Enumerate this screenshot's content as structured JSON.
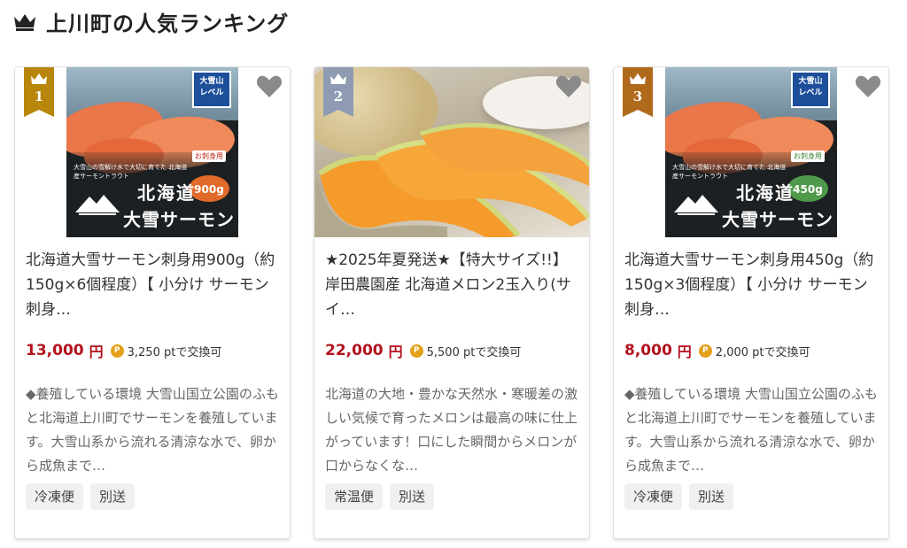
{
  "heading": {
    "title": "上川町の人気ランキング",
    "icon": "crown-icon"
  },
  "colors": {
    "gold": "#b8860b",
    "silver": "#8e9bb3",
    "price_red": "#b3121e",
    "point_coin": "#e3a019"
  },
  "products": [
    {
      "rank": "1",
      "rank_color": "#b8860b",
      "image": {
        "brand_badge": "大雪山\nレベル",
        "catch": "大雪山の雪解け水で大切に育てた 北海道産サーモントラウト",
        "weight_tag": "お刺身用",
        "weight": "900g",
        "weight_color": "#e06a2a",
        "title1": "北海道",
        "title2": "大雪サーモン"
      },
      "title": "北海道大雪サーモン刺身用900g（約150g×6個程度）【 小分け サーモン 刺身…",
      "price": "13,000",
      "yen": "円",
      "points": "3,250 ptで交換可",
      "description": "◆養殖している環境 大雪山国立公園のふもと北海道上川町でサーモンを養殖しています。大雪山系から流れる清涼な水で、卵から成魚まで…",
      "tags": [
        "冷凍便",
        "別送"
      ]
    },
    {
      "rank": "2",
      "rank_color": "#8e9bb3",
      "title": "★2025年夏発送★【特大サイズ!!】岸田農園産 北海道メロン2玉入り(サイ…",
      "price": "22,000",
      "yen": "円",
      "points": "5,500 ptで交換可",
      "description": "北海道の大地・豊かな天然水・寒暖差の激しい気候で育ったメロンは最高の味に仕上がっています！口にした瞬間からメロンが口からなくな…",
      "tags": [
        "常温便",
        "別送"
      ]
    },
    {
      "rank": "3",
      "rank_color": "#b06a1c",
      "image": {
        "brand_badge": "大雪山\nレベル",
        "catch": "大雪山の雪解け水で大切に育てた 北海道産サーモントラウト",
        "weight_tag": "お刺身用",
        "weight": "450g",
        "weight_color": "#4f9a4a",
        "title1": "北海道",
        "title2": "大雪サーモン"
      },
      "title": "北海道大雪サーモン刺身用450g（約150g×3個程度）【 小分け サーモン 刺身…",
      "price": "8,000",
      "yen": "円",
      "points": "2,000 ptで交換可",
      "description": "◆養殖している環境 大雪山国立公園のふもと北海道上川町でサーモンを養殖しています。大雪山系から流れる清涼な水で、卵から成魚まで…",
      "tags": [
        "冷凍便",
        "別送"
      ]
    }
  ]
}
